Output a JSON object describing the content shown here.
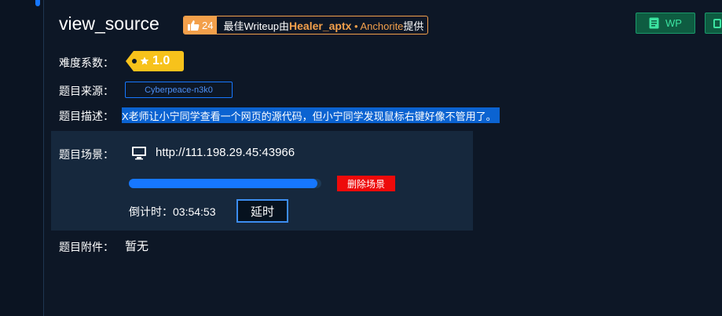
{
  "challenge": {
    "title": "view_source",
    "likes": "24",
    "writeup_prefix": "最佳Writeup由",
    "writeup_author": "Healer_aptx",
    "writeup_sep": " • ",
    "writeup_org": "Anchorite",
    "writeup_suffix": "提供",
    "wp_label": "WP"
  },
  "difficulty": {
    "label": "难度系数：",
    "value": "1.0",
    "color": "#f7c21b"
  },
  "source": {
    "label": "题目来源：",
    "value": "Cyberpeace-n3k0"
  },
  "description": {
    "label": "题目描述：",
    "value": "X老师让小宁同学查看一个网页的源代码，但小宁同学发现鼠标右键好像不管用了。"
  },
  "scene": {
    "label": "题目场景：",
    "url": "http://111.198.29.45:43966",
    "progress": 0.98,
    "delete_label": "删除场景",
    "countdown_label": "倒计时：",
    "countdown_value": "03:54:53",
    "extend_label": "延时"
  },
  "attachment": {
    "label": "题目附件：",
    "value": "暂无"
  },
  "colors": {
    "accent": "#1677ff",
    "warning": "#f3a04b",
    "danger": "#ee0a0a",
    "wp": "#3ce3a1"
  },
  "icons": [
    "thumbs-up-icon",
    "star-icon",
    "monitor-icon",
    "document-icon"
  ]
}
